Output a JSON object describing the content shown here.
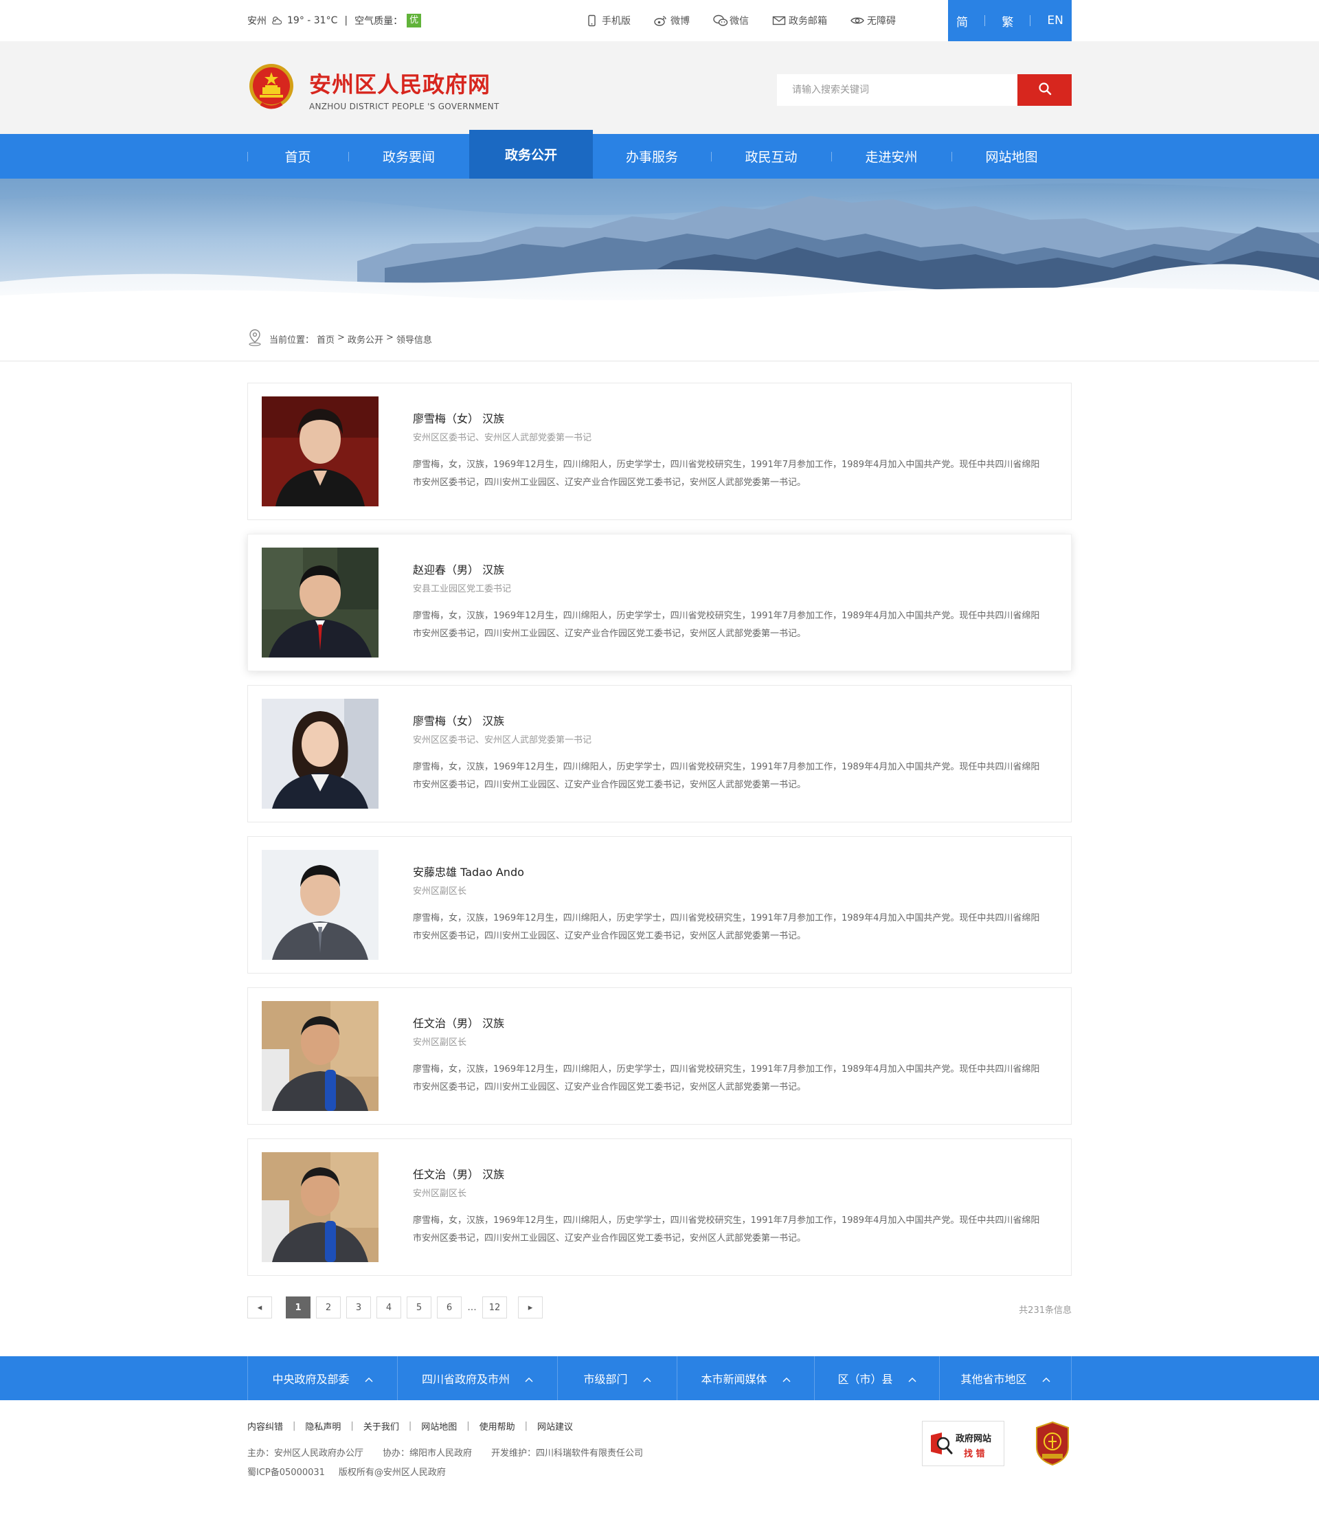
{
  "topbar": {
    "city": "安州",
    "weather": "19° - 31°C",
    "divider": "|",
    "air_label": "空气质量：",
    "air_value": "优",
    "links": [
      {
        "icon": "mobile-icon",
        "label": "手机版"
      },
      {
        "icon": "weibo-icon",
        "label": "微博"
      },
      {
        "icon": "wechat-icon",
        "label": "微信"
      },
      {
        "icon": "mail-icon",
        "label": "政务邮箱"
      },
      {
        "icon": "eye-icon",
        "label": "无障碍"
      }
    ],
    "lang": [
      "简",
      "繁",
      "EN"
    ]
  },
  "header": {
    "title": "安州区人民政府网",
    "subtitle": "ANZHOU DISTRICT PEOPLE 'S GOVERNMENT",
    "search_placeholder": "请输入搜索关键词"
  },
  "nav": {
    "items": [
      "首页",
      "政务要闻",
      "政务公开",
      "办事服务",
      "政民互动",
      "走进安州",
      "网站地图"
    ],
    "active_index": 2
  },
  "breadcrumb": {
    "label": "当前位置：",
    "path": [
      "首页",
      "政务公开",
      "领导信息"
    ],
    "sep": ">"
  },
  "leaders": [
    {
      "name": "廖雪梅（女） 汉族",
      "post": "安州区区委书记、安州区人武部党委第一书记",
      "bio": "廖雪梅，女，汉族，1969年12月生，四川绵阳人，历史学学士，四川省党校研究生，1991年7月参加工作，1989年4月加入中国共产党。现任中共四川省绵阳市安州区委书记，四川安州工业园区、辽安产业合作园区党工委书记，安州区人武部党委第一书记。"
    },
    {
      "name": "赵迎春（男） 汉族",
      "post": "安县工业园区党工委书记",
      "bio": "廖雪梅，女，汉族，1969年12月生，四川绵阳人，历史学学士，四川省党校研究生，1991年7月参加工作，1989年4月加入中国共产党。现任中共四川省绵阳市安州区委书记，四川安州工业园区、辽安产业合作园区党工委书记，安州区人武部党委第一书记。"
    },
    {
      "name": "廖雪梅（女） 汉族",
      "post": "安州区区委书记、安州区人武部党委第一书记",
      "bio": "廖雪梅，女，汉族，1969年12月生，四川绵阳人，历史学学士，四川省党校研究生，1991年7月参加工作，1989年4月加入中国共产党。现任中共四川省绵阳市安州区委书记，四川安州工业园区、辽安产业合作园区党工委书记，安州区人武部党委第一书记。"
    },
    {
      "name": "安藤忠雄 Tadao Ando",
      "post": "安州区副区长",
      "bio": "廖雪梅，女，汉族，1969年12月生，四川绵阳人，历史学学士，四川省党校研究生，1991年7月参加工作，1989年4月加入中国共产党。现任中共四川省绵阳市安州区委书记，四川安州工业园区、辽安产业合作园区党工委书记，安州区人武部党委第一书记。"
    },
    {
      "name": "任文治（男） 汉族",
      "post": "安州区副区长",
      "bio": "廖雪梅，女，汉族，1969年12月生，四川绵阳人，历史学学士，四川省党校研究生，1991年7月参加工作，1989年4月加入中国共产党。现任中共四川省绵阳市安州区委书记，四川安州工业园区、辽安产业合作园区党工委书记，安州区人武部党委第一书记。"
    },
    {
      "name": "任文治（男） 汉族",
      "post": "安州区副区长",
      "bio": "廖雪梅，女，汉族，1969年12月生，四川绵阳人，历史学学士，四川省党校研究生，1991年7月参加工作，1989年4月加入中国共产党。现任中共四川省绵阳市安州区委书记，四川安州工业园区、辽安产业合作园区党工委书记，安州区人武部党委第一书记。"
    }
  ],
  "pagination": {
    "prev": "◂",
    "next": "▸",
    "pages": [
      "1",
      "2",
      "3",
      "4",
      "5",
      "6"
    ],
    "ellipsis": "...",
    "last": "12",
    "current": "1",
    "total": "共231条信息"
  },
  "footer_bar": [
    "中央政府及部委",
    "四川省政府及市州",
    "市级部门",
    "本市新闻媒体",
    "区（市）县",
    "其他省市地区"
  ],
  "footer": {
    "links": [
      "内容纠错",
      "隐私声明",
      "关于我们",
      "网站地图",
      "使用帮助",
      "网站建议"
    ],
    "host": "主办：安州区人民政府办公厅",
    "co": "协办：绵阳市人民政府",
    "dev": "开发维护：四川科瑞软件有限责任公司",
    "icp": "蜀ICP备05000031",
    "copyright": "版权所有@安州区人民政府",
    "badge_line1": "政府网站",
    "badge_line2": "找 错"
  },
  "colors": {
    "brand_blue": "#2a82e4",
    "nav_active": "#1b69c2",
    "red": "#d7261e",
    "air_green": "#61b33a"
  }
}
